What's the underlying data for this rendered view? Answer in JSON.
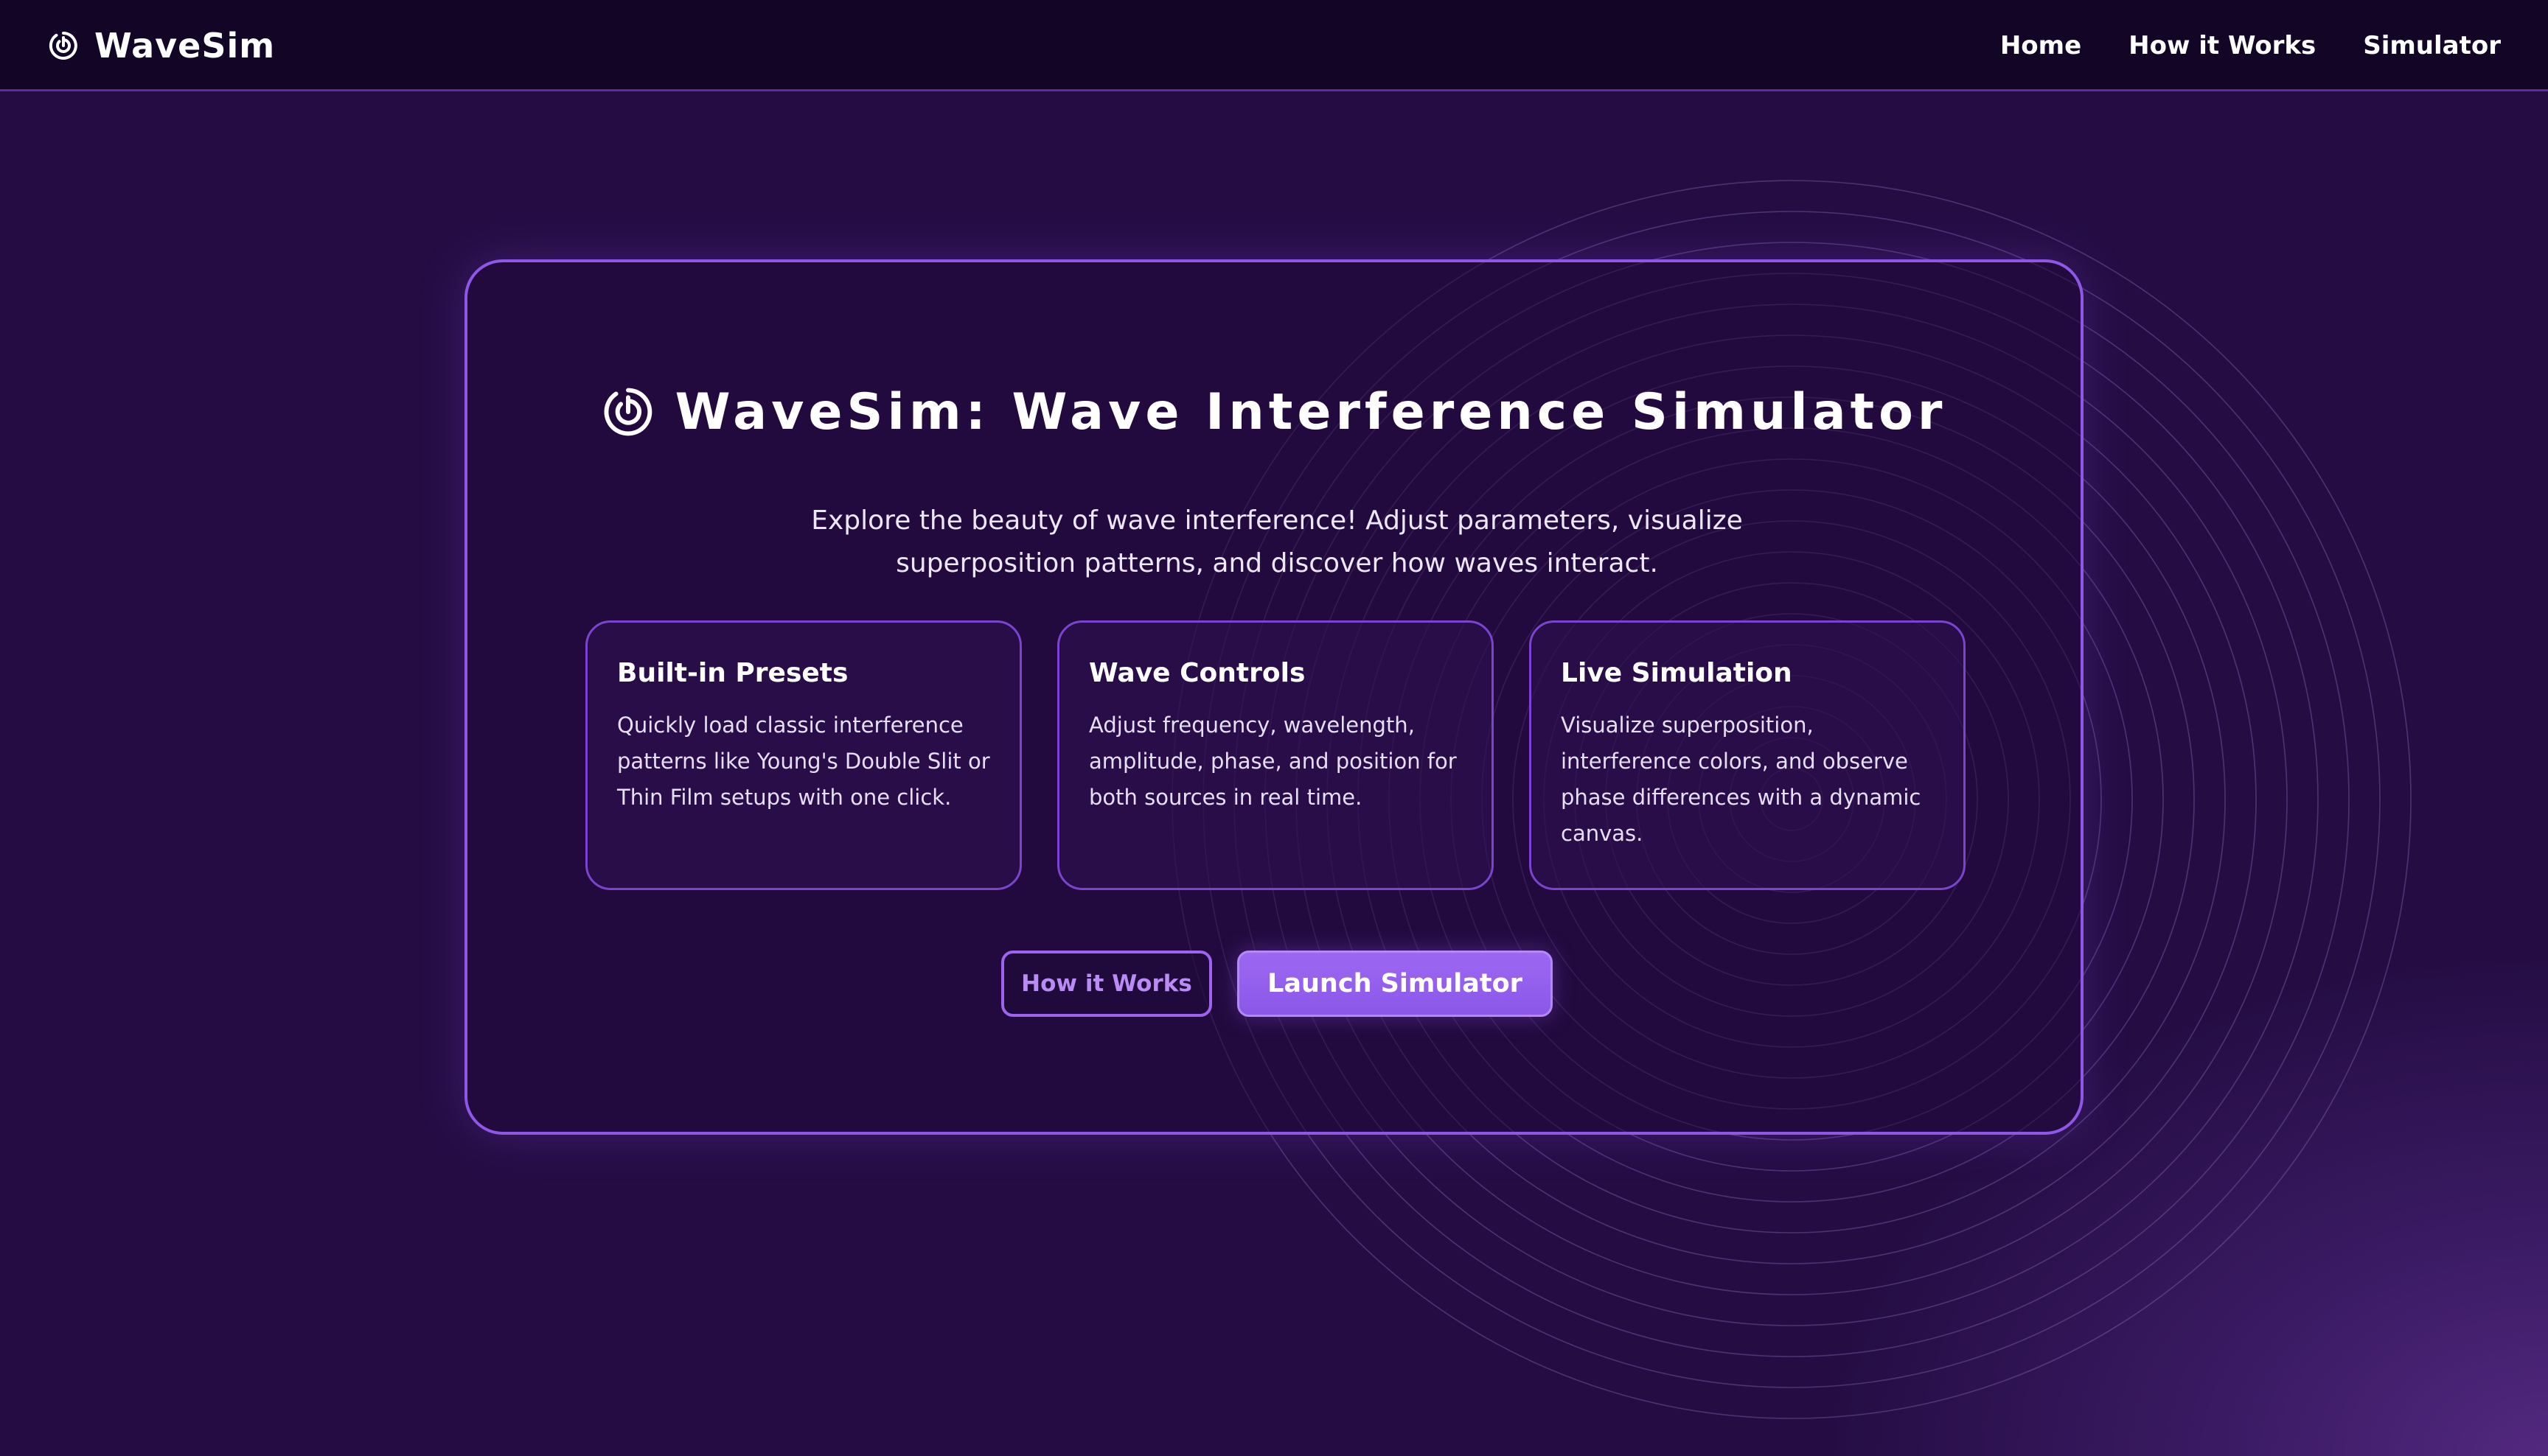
{
  "brand": {
    "icon": "wave-logo-icon",
    "name": "WaveSim"
  },
  "nav": {
    "items": [
      {
        "label": "Home"
      },
      {
        "label": "How it Works"
      },
      {
        "label": "Simulator"
      }
    ]
  },
  "hero": {
    "icon": "wave-logo-icon",
    "title": "WaveSim: Wave Interference Simulator",
    "subtitle": "Explore the beauty of wave interference! Adjust parameters, visualize superposition patterns, and discover how waves interact.",
    "features": [
      {
        "title": "Built-in Presets",
        "description": "Quickly load classic interference patterns like Young's Double Slit or Thin Film setups with one click."
      },
      {
        "title": "Wave Controls",
        "description": "Adjust frequency, wavelength, amplitude, phase, and position for both sources in real time."
      },
      {
        "title": "Live Simulation",
        "description": "Visualize superposition, interference colors, and observe phase differences with a dynamic canvas."
      }
    ],
    "buttons": {
      "secondary_label": "How it Works",
      "primary_label": "Launch Simulator"
    }
  },
  "theme": {
    "background": "#250d44",
    "navbar_background": "#130525",
    "accent": "#8f57e6",
    "button_primary": "#9c68f2",
    "button_outline_text": "#b98cf5",
    "ripple_color": "#a78bdb"
  }
}
